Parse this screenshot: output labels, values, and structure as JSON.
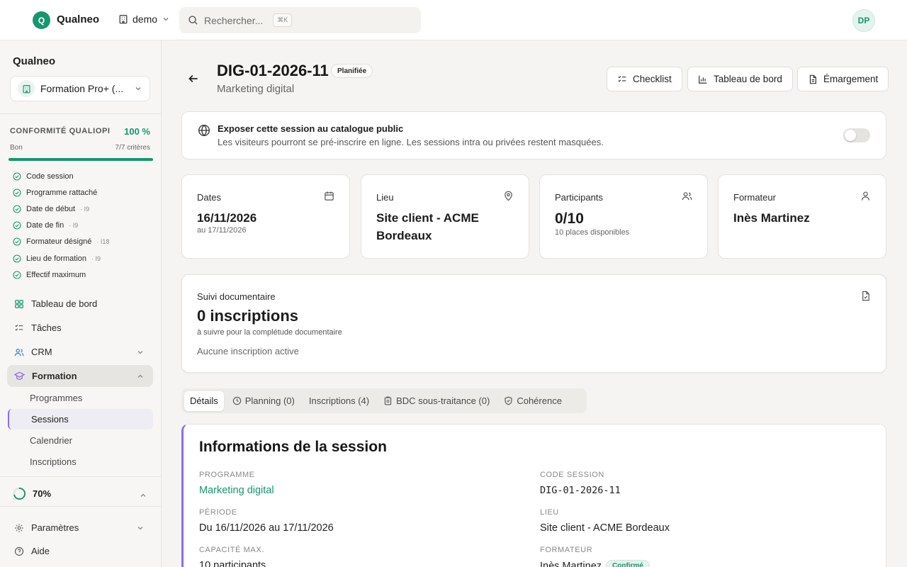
{
  "app": {
    "logo_letter": "Q",
    "name": "Qualneo",
    "org": "demo",
    "search_placeholder": "Rechercher...",
    "search_shortcut": "⌘K",
    "user_initials": "DP",
    "accent_color": "#18956f",
    "formation_color": "#8b6cf1"
  },
  "sidebar": {
    "title": "Qualneo",
    "workspace": "Formation Pro+ (...",
    "conformity": {
      "title": "CONFORMITÉ QUALIOPI",
      "percent": "100 %",
      "level": "Bon",
      "criteria": "7/7 critères",
      "progress": 1.0,
      "items": [
        {
          "label": "Code session",
          "ref": ""
        },
        {
          "label": "Programme rattaché",
          "ref": ""
        },
        {
          "label": "Date de début",
          "ref": "· I9"
        },
        {
          "label": "Date de fin",
          "ref": "· I9"
        },
        {
          "label": "Formateur désigné",
          "ref": "· I18"
        },
        {
          "label": "Lieu de formation",
          "ref": "· I9"
        },
        {
          "label": "Effectif maximum",
          "ref": ""
        }
      ]
    },
    "nav": {
      "dashboard": "Tableau de bord",
      "tasks": "Tâches",
      "crm": "CRM",
      "formation": "Formation",
      "sub": {
        "programmes": "Programmes",
        "sessions": "Sessions",
        "calendar": "Calendrier",
        "inscriptions": "Inscriptions"
      },
      "settings": "Paramètres",
      "help": "Aide"
    },
    "progress": {
      "label": "70%",
      "value": 0.7
    }
  },
  "header": {
    "title": "DIG-01-2026-11",
    "status": "Planifiée",
    "subtitle": "Marketing digital",
    "buttons": {
      "checklist": "Checklist",
      "dashboard": "Tableau de bord",
      "attendance": "Émargement"
    }
  },
  "expose": {
    "title": "Exposer cette session au catalogue public",
    "description": "Les visiteurs pourront se pré-inscrire en ligne. Les sessions intra ou privées restent masquées.",
    "enabled": false
  },
  "stats": {
    "dates": {
      "label": "Dates",
      "value": "16/11/2026",
      "sub": "au 17/11/2026"
    },
    "location": {
      "label": "Lieu",
      "value": "Site client - ACME Bordeaux"
    },
    "participants": {
      "label": "Participants",
      "value": "0/10",
      "sub": "10 places disponibles"
    },
    "trainer": {
      "label": "Formateur",
      "value": "Inès Martinez"
    }
  },
  "suivi": {
    "title": "Suivi documentaire",
    "value": "0 inscriptions",
    "sub": "à suivre pour la complétude documentaire",
    "empty": "Aucune inscription active"
  },
  "tabs": {
    "details": "Détails",
    "planning": "Planning (0)",
    "inscriptions": "Inscriptions (4)",
    "bdc": "BDC sous-traitance (0)",
    "coherence": "Cohérence"
  },
  "info": {
    "title": "Informations de la session",
    "programme_label": "PROGRAMME",
    "programme_value": "Marketing digital",
    "code_label": "CODE SESSION",
    "code_value": "DIG-01-2026-11",
    "period_label": "PÉRIODE",
    "period_value": "Du 16/11/2026 au 17/11/2026",
    "location_label": "LIEU",
    "location_value": "Site client - ACME Bordeaux",
    "capacity_label": "CAPACITÉ MAX.",
    "capacity_value": "10 participants",
    "trainer_label": "FORMATEUR",
    "trainer_value": "Inès Martinez",
    "trainer_status": "Confirmé"
  }
}
